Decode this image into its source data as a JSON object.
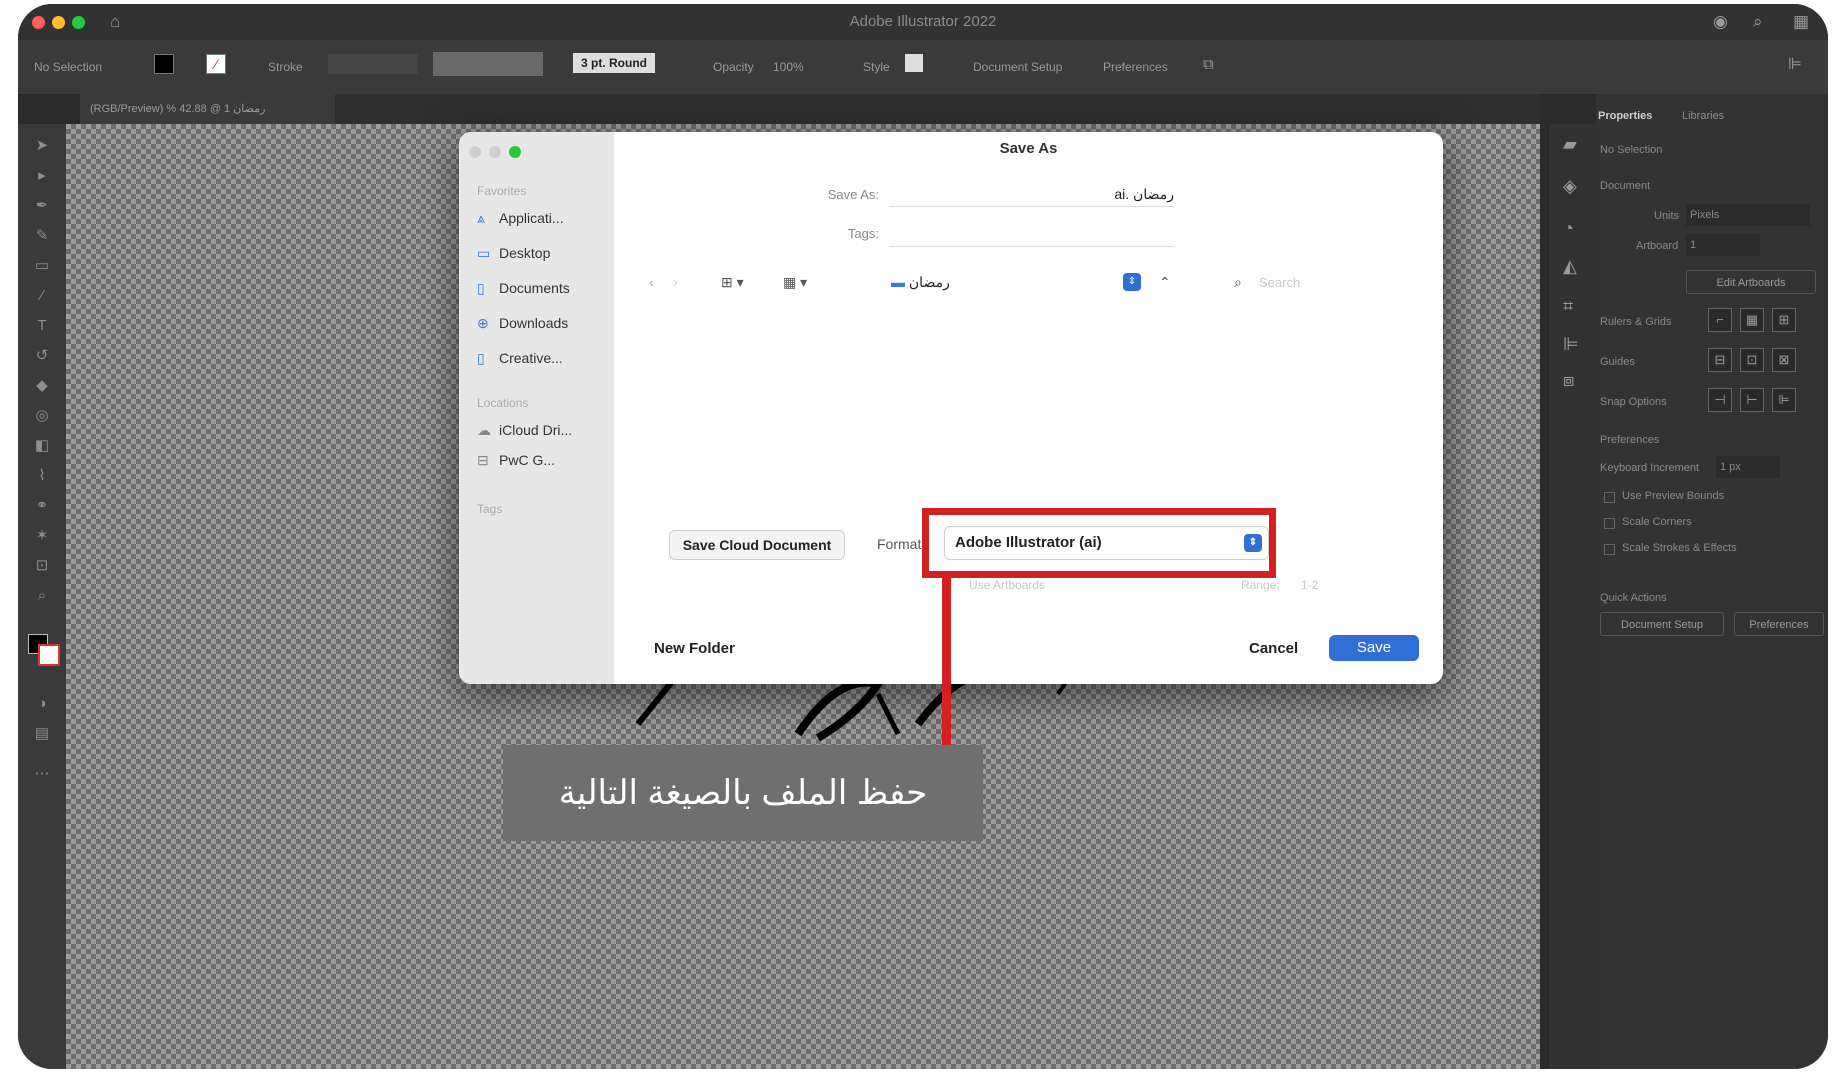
{
  "app": {
    "window_title": "Adobe Illustrator 2022",
    "document_tab": "(RGB/Preview) % 42.88 @ 1 رمضان"
  },
  "control_bar": {
    "selection": "No Selection",
    "stroke_label": "Stroke",
    "brush": "3 pt. Round",
    "opacity_label": "Opacity",
    "opacity_value": "100%",
    "style_label": "Style",
    "document_setup": "Document Setup",
    "preferences": "Preferences"
  },
  "properties_panel": {
    "tabs": [
      "Properties",
      "Libraries"
    ],
    "no_selection": "No Selection",
    "document_header": "Document",
    "units_label": "Units",
    "units_value": "Pixels",
    "artboard_label": "Artboard",
    "artboard_value": "1",
    "edit_artboards": "Edit Artboards",
    "rulers_grids": "Rulers & Grids",
    "guides": "Guides",
    "snap_options": "Snap Options",
    "preferences_header": "Preferences",
    "keyboard_increment_label": "Keyboard Increment",
    "keyboard_increment_value": "1 px",
    "checkboxes": [
      "Use Preview Bounds",
      "Scale Corners",
      "Scale Strokes & Effects"
    ],
    "quick_actions": "Quick Actions",
    "qa_document_setup": "Document Setup",
    "qa_preferences": "Preferences"
  },
  "dialog": {
    "title": "Save As",
    "sidebar": {
      "favorites_header": "Favorites",
      "favorites": [
        "Applicati...",
        "Desktop",
        "Documents",
        "Downloads",
        "Creative..."
      ],
      "locations_header": "Locations",
      "locations": [
        "iCloud Dri...",
        "PwC G..."
      ],
      "tags_header": "Tags"
    },
    "save_as_label": "Save As:",
    "save_as_value": "رمضان .ai",
    "tags_label": "Tags:",
    "location_folder": "رمضان",
    "search_placeholder": "Search",
    "save_cloud_document": "Save Cloud Document",
    "format_label": "Format:",
    "format_value": "Adobe Illustrator (ai)",
    "use_artboards": "Use Artboards",
    "range_label": "Range:",
    "range_value": "1-2",
    "new_folder": "New Folder",
    "cancel": "Cancel",
    "save": "Save"
  },
  "callout": {
    "text": "حفظ الملف بالصيغة التالية"
  },
  "colors": {
    "highlight": "#d42020",
    "accent": "#2f6fd6"
  }
}
